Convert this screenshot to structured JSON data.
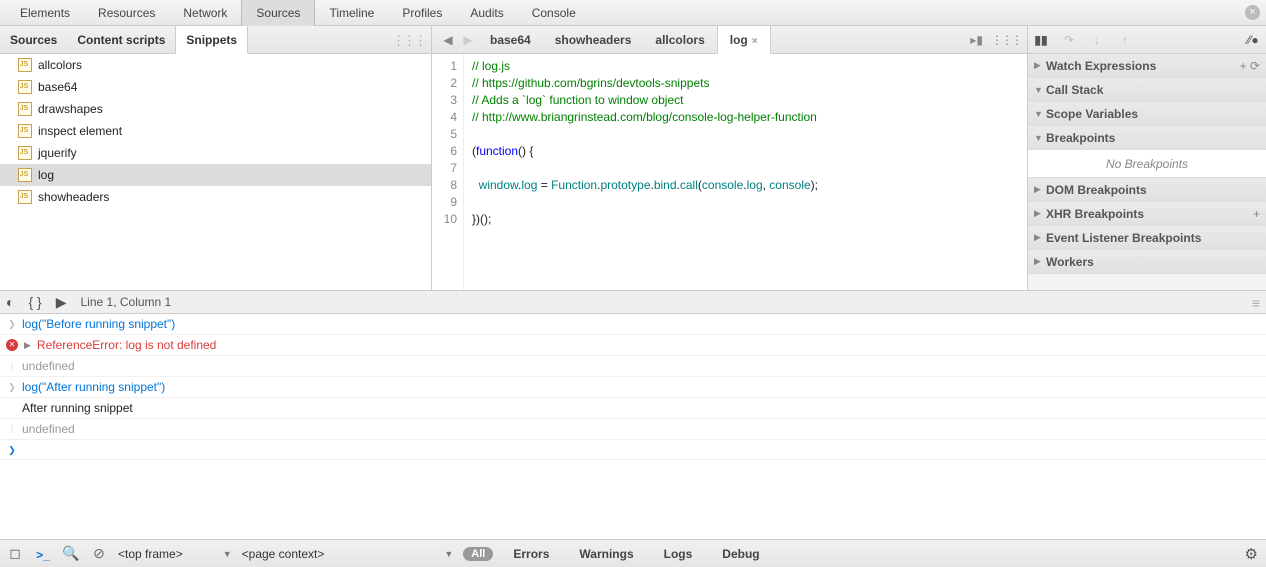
{
  "top_tabs": [
    "Elements",
    "Resources",
    "Network",
    "Sources",
    "Timeline",
    "Profiles",
    "Audits",
    "Console"
  ],
  "top_selected": "Sources",
  "left_tabs": [
    "Sources",
    "Content scripts",
    "Snippets"
  ],
  "left_selected": "Snippets",
  "snippets": [
    "allcolors",
    "base64",
    "drawshapes",
    "inspect element",
    "jquerify",
    "log",
    "showheaders"
  ],
  "snippet_selected": "log",
  "editor_tabs": [
    "base64",
    "showheaders",
    "allcolors",
    "log"
  ],
  "editor_selected": "log",
  "code_lines": [
    {
      "n": 1,
      "raw": "// log.js",
      "cls": "comment"
    },
    {
      "n": 2,
      "raw": "// https://github.com/bgrins/devtools-snippets",
      "cls": "comment"
    },
    {
      "n": 3,
      "raw": "// Adds a `log` function to window object",
      "cls": "comment"
    },
    {
      "n": 4,
      "raw": "// http://www.briangrinstead.com/blog/console-log-helper-function",
      "cls": "comment"
    },
    {
      "n": 5,
      "raw": "",
      "cls": ""
    },
    {
      "n": 6,
      "raw": "(function() {",
      "cls": "fnline"
    },
    {
      "n": 7,
      "raw": "",
      "cls": ""
    },
    {
      "n": 8,
      "raw": "  window.log = Function.prototype.bind.call(console.log, console);",
      "cls": "bodyline"
    },
    {
      "n": 9,
      "raw": "",
      "cls": ""
    },
    {
      "n": 10,
      "raw": "})();",
      "cls": ""
    }
  ],
  "cursor": "Line 1, Column 1",
  "accordions": [
    {
      "label": "Watch Expressions",
      "open": false,
      "extra": "+ ⟳"
    },
    {
      "label": "Call Stack",
      "open": true
    },
    {
      "label": "Scope Variables",
      "open": true
    },
    {
      "label": "Breakpoints",
      "open": true,
      "body": "No Breakpoints"
    },
    {
      "label": "DOM Breakpoints",
      "open": false
    },
    {
      "label": "XHR Breakpoints",
      "open": false,
      "extra": "+"
    },
    {
      "label": "Event Listener Breakpoints",
      "open": false
    },
    {
      "label": "Workers",
      "open": false
    }
  ],
  "console": [
    {
      "type": "in",
      "text": "log(\"Before running snippet\")"
    },
    {
      "type": "err",
      "text": "ReferenceError: log is not defined"
    },
    {
      "type": "und",
      "text": "undefined"
    },
    {
      "type": "in",
      "text": "log(\"After running snippet\")"
    },
    {
      "type": "out",
      "text": "After running snippet"
    },
    {
      "type": "und",
      "text": "undefined"
    }
  ],
  "frame_select": "<top frame>",
  "context_select": "<page context>",
  "filters": [
    "Errors",
    "Warnings",
    "Logs",
    "Debug"
  ],
  "all_label": "All"
}
